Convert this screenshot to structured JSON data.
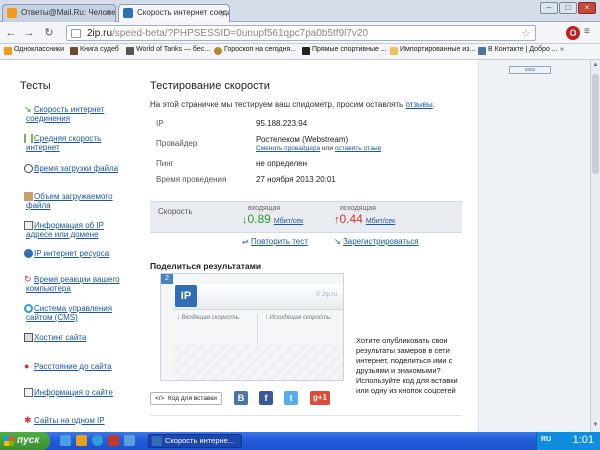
{
  "browser": {
    "tabs": [
      {
        "label": "Ответы@Mail.Ru: Человек",
        "active": false
      },
      {
        "label": "Скорость интернет соеди",
        "active": true
      }
    ],
    "url_host": "2ip.ru",
    "url_path": "/speed-beta/?PHPSESSID=0unupf561qpc7pa0b5tf9l7v20",
    "bookmarks": [
      "Одноклассники",
      "Книга судеб",
      "World of Tanks — бес...",
      "Гороскоп на сегодня...",
      "Прямые спортивные ...",
      "Импортированные из...",
      "В Контакте | Добро ..."
    ],
    "bookmarks_more": "»"
  },
  "sidebar": {
    "title": "Тесты",
    "items": [
      [
        "Скорость интернет",
        "соединения"
      ],
      [
        "Средняя скорость",
        "интернет"
      ],
      [
        "Время загрузки файла"
      ],
      [
        "Объем загружаемого",
        "файла"
      ],
      [
        "Информация об IP",
        "адресе или домене"
      ],
      [
        "IP интернет ресурса"
      ],
      [
        "Время реакции вашего",
        "компьютера"
      ],
      [
        "Система управления",
        "сайтом (CMS)"
      ],
      [
        "Хостинг сайта"
      ],
      [
        "Расстояние до сайта"
      ],
      [
        "Информация о сайте"
      ],
      [
        "Сайты на одном IP"
      ]
    ]
  },
  "main": {
    "title": "Тестирование скорости",
    "intro_text": "На этой страничке мы тестируем ваш спидометр, просим оставлять ",
    "intro_link": "отзывы",
    "intro_end": ".",
    "info": {
      "ip_label": "IP",
      "ip_value": "95.188.223.94",
      "provider_label": "Провайдер",
      "provider_value": "Ростелеком (Webstream)",
      "change_provider": "Сменить провайдера",
      "or_text": " или ",
      "leave_review": "оставить отзыв",
      "ping_label": "Пинг",
      "ping_value": "не определен",
      "time_label": "Время проведения",
      "time_value": "27 ноября 2013 20:01"
    },
    "speed": {
      "label": "Скорость",
      "in_caption": "входящая",
      "in_value": "0.89",
      "out_caption": "исходящая",
      "out_value": "0.44",
      "unit": "Мбит/сек"
    },
    "repeat_test": "Повторить тест",
    "register": "Зарегистрироваться",
    "share": {
      "title": "Поделиться результатами",
      "badge": "2",
      "logo": "IP",
      "site": "© 2ip.ru",
      "in_label": "↓ Входящая скорость:",
      "out_label": "↑ Исходящая скорость:",
      "text": "Хотите опубликовать свои результаты замеров в сети интернет, поделиться ими с друзьями и знакомыми? Используйте код для вставки или одну из кнопок соцсетей",
      "embed": "Код для вставки",
      "vk": "B",
      "fb": "f",
      "tw": "t",
      "gp": "g+1"
    },
    "right_box": "ssss"
  },
  "taskbar": {
    "start": "пуск",
    "task_label": "Скорость интерне...",
    "lang": "RU",
    "clock": "1:01"
  }
}
